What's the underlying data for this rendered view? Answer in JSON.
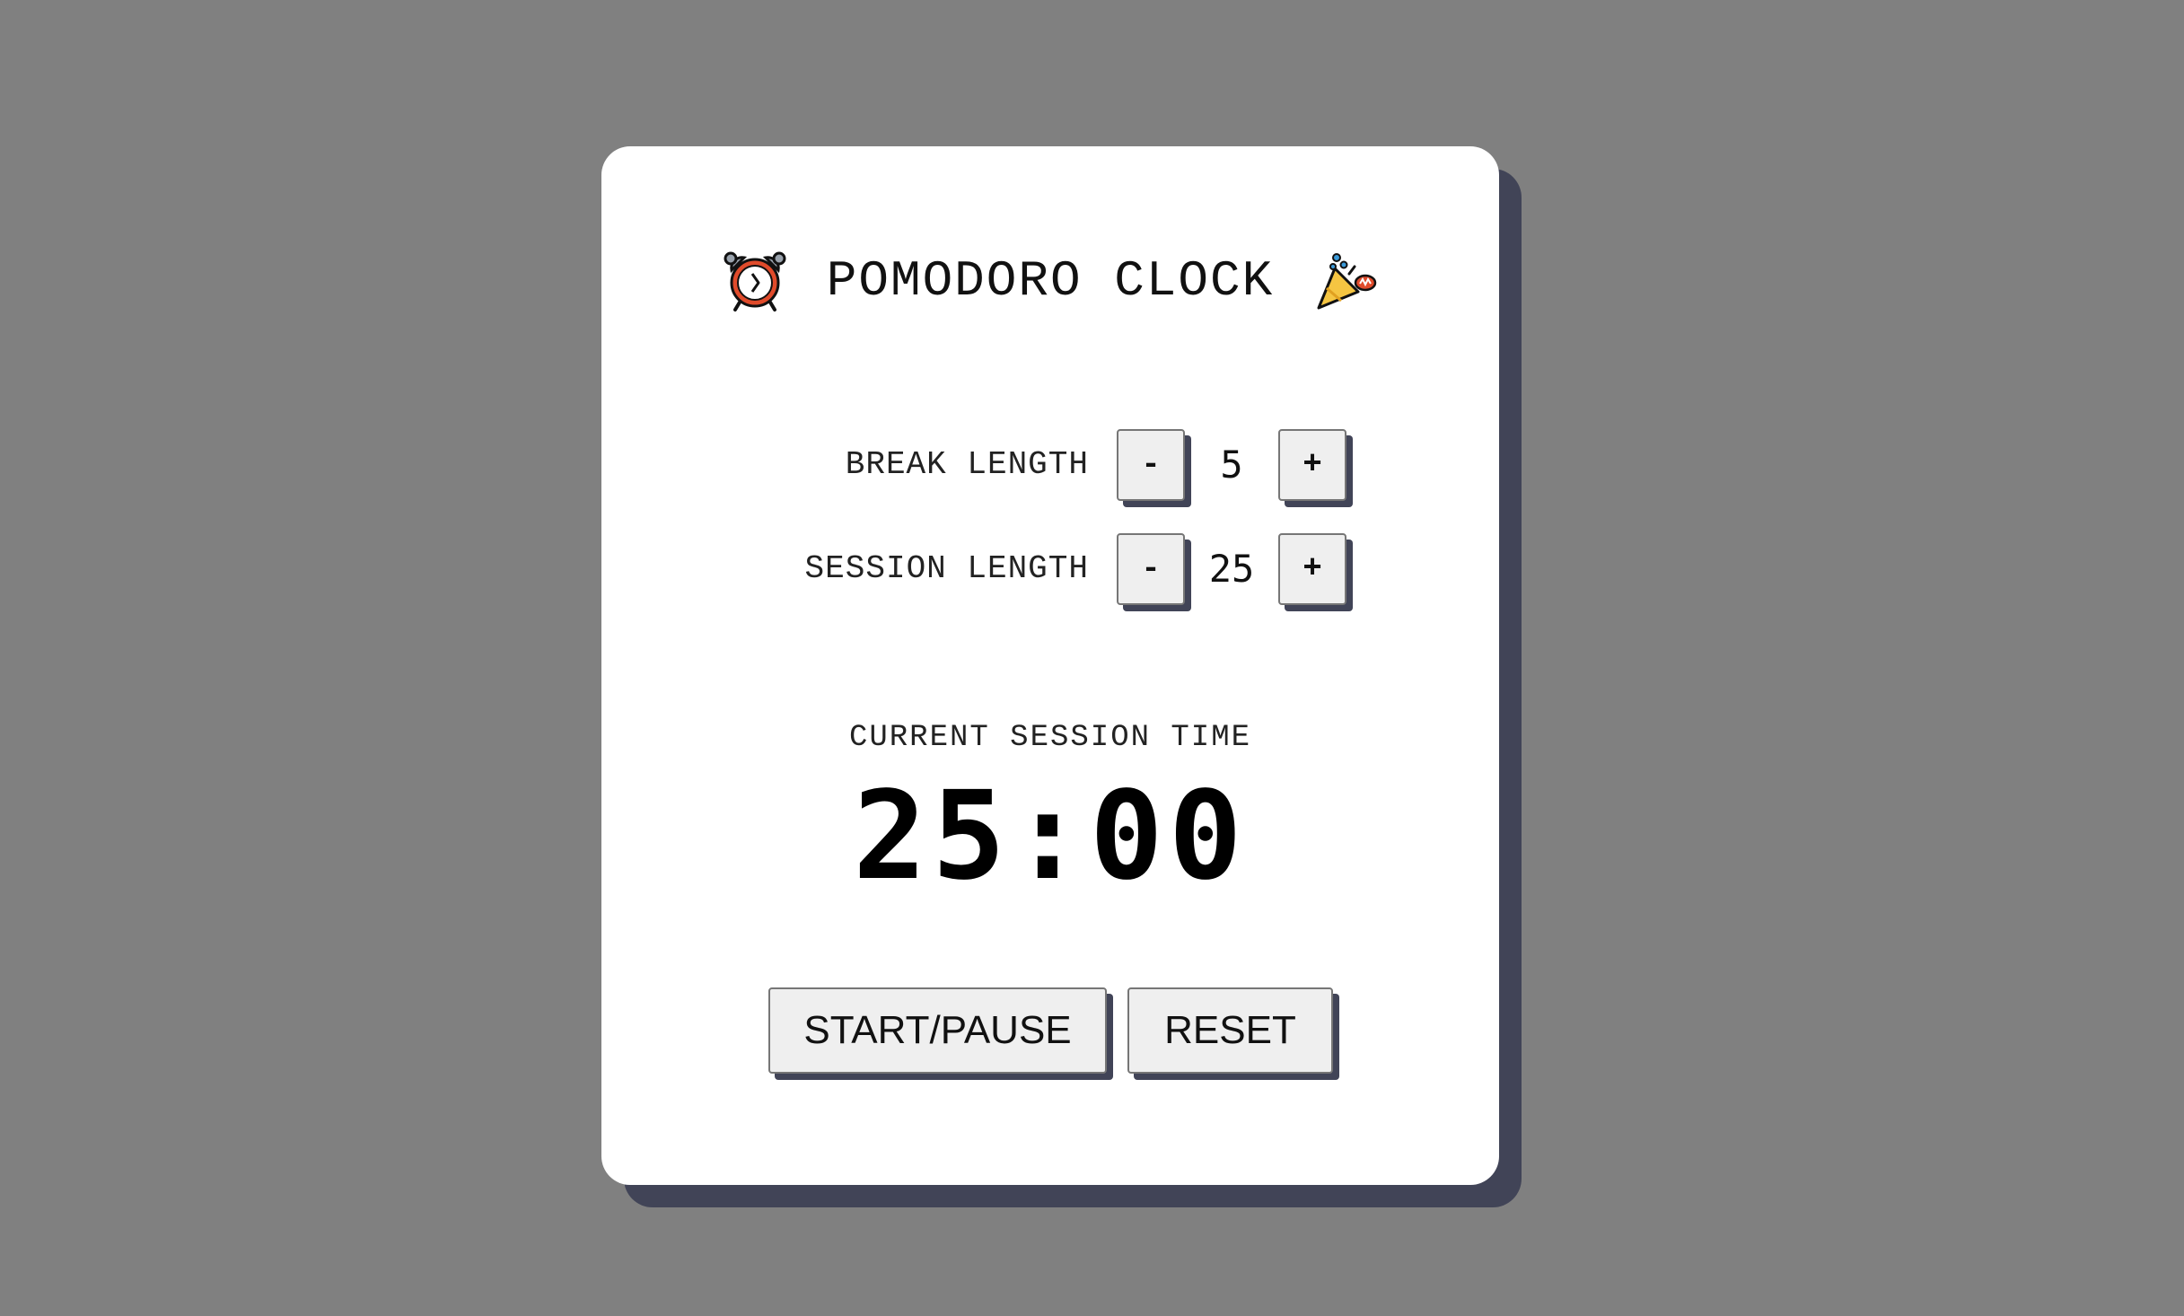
{
  "header": {
    "title": "POMODORO CLOCK",
    "left_icon": "alarm-clock-icon",
    "right_icon": "party-popper-icon"
  },
  "break": {
    "label": "BREAK LENGTH",
    "decrement_label": "-",
    "value": "5",
    "increment_label": "+"
  },
  "session": {
    "label": "SESSION LENGTH",
    "decrement_label": "-",
    "value": "25",
    "increment_label": "+"
  },
  "timer": {
    "caption": "CURRENT SESSION TIME",
    "display": "25:00"
  },
  "controls": {
    "start_pause_label": "START/PAUSE",
    "reset_label": "RESET"
  },
  "colors": {
    "background": "#808080",
    "card": "#ffffff",
    "shadow": "#414457",
    "button": "#efefef"
  }
}
